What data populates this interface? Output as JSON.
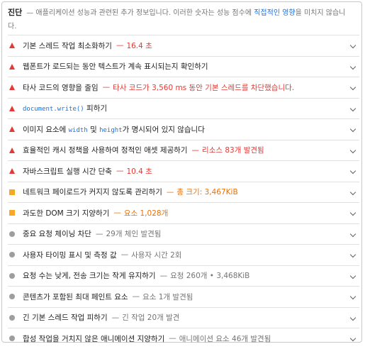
{
  "header": {
    "title": "진단",
    "desc_pre": "— 애플리케이션 성능과 관련된 추가 정보입니다. 이러한 숫자는 성능 점수에 ",
    "desc_link": "직접적인 영향",
    "desc_post": "을 미치지 않습니다."
  },
  "items": [
    {
      "severity": "fail",
      "label": "기본 스레드 작업 최소화하기",
      "detail": "16.4 초"
    },
    {
      "severity": "fail",
      "label": "웹폰트가 로드되는 동안 텍스트가 계속 표시되는지 확인하기",
      "detail": ""
    },
    {
      "severity": "fail",
      "label": "타사 코드의 영향을 줄임",
      "detail": "타사 코드가 3,560 ms 동안 기본 스레드를 차단했습니다."
    },
    {
      "severity": "fail",
      "label_pre": "",
      "code1": "document.write()",
      "label_post": " 피하기",
      "detail": ""
    },
    {
      "severity": "fail",
      "label_pre": "이미지 요소에 ",
      "code1": "width",
      "label_mid": " 및 ",
      "code2": "height",
      "label_post": "가 명시되어 있지 않습니다",
      "detail": ""
    },
    {
      "severity": "fail",
      "label": "효율적인 캐시 정책을 사용하여 정적인 애셋 제공하기",
      "detail": "리소스 83개 발견됨"
    },
    {
      "severity": "fail",
      "label": "자바스크립트 실행 시간 단축",
      "detail": "10.4 초"
    },
    {
      "severity": "average",
      "label": "네트워크 페이로드가 커지지 않도록 관리하기",
      "detail": "총 크기: 3,467KiB"
    },
    {
      "severity": "average",
      "label": "과도한 DOM 크기 지양하기",
      "detail": "요소 1,028개"
    },
    {
      "severity": "info",
      "label": "중요 요청 체이닝 차단",
      "detail": "29개 체인 발견됨"
    },
    {
      "severity": "info",
      "label": "사용자 타이밍 표시 및 측정 값",
      "detail": "사용자 시간 2회"
    },
    {
      "severity": "info",
      "label": "요청 수는 낮게, 전송 크기는 작게 유지하기",
      "detail": "요청 260개 • 3,468KiB"
    },
    {
      "severity": "info",
      "label": "콘텐츠가 포함된 최대 페인트 요소",
      "detail": "요소 1개 발견됨"
    },
    {
      "severity": "info",
      "label": "긴 기본 스레드 작업 피하기",
      "detail": "긴 작업 20개 발견"
    },
    {
      "severity": "info",
      "label": "합성 작업을 거치지 않은 애니메이션 지양하기",
      "detail": "애니메이션 요소 46개 발견됨"
    }
  ],
  "icons": {
    "fail": "red-triangle-icon",
    "average": "orange-square-icon",
    "info": "gray-circle-icon",
    "expand": "chevron-down-icon"
  },
  "colors": {
    "fail": "#e53935",
    "average": "#e8710a",
    "info": "#757575",
    "link": "#1a73e8"
  }
}
